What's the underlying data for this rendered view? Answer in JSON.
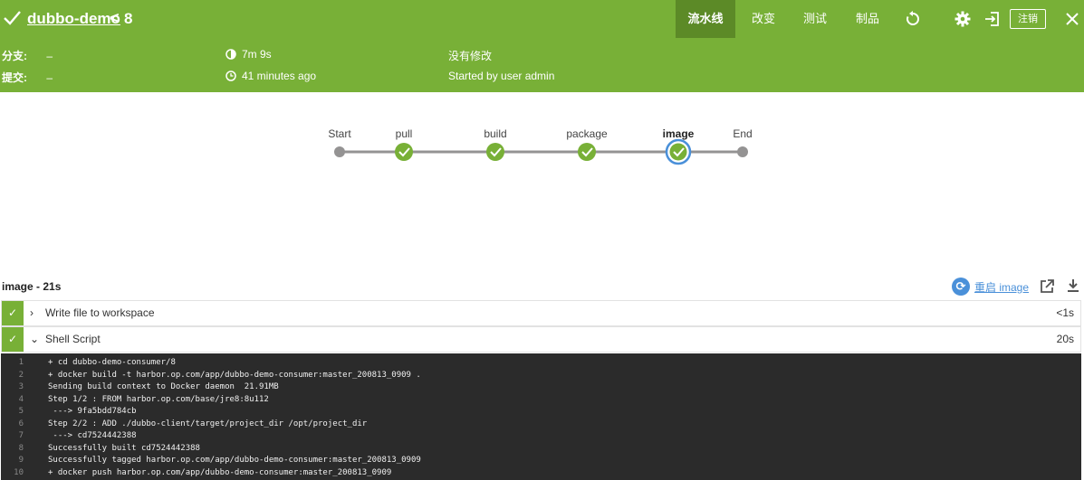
{
  "header": {
    "title": "dubbo-demo",
    "separator": "<",
    "run_number": "8",
    "tabs": [
      {
        "label": "流水线",
        "active": true
      },
      {
        "label": "改变",
        "active": false
      },
      {
        "label": "测试",
        "active": false
      },
      {
        "label": "制品",
        "active": false
      }
    ],
    "logout_label": "注销",
    "accent_color": "#78b037"
  },
  "meta": {
    "branch_label": "分支:",
    "branch_value": "–",
    "commit_label": "提交:",
    "commit_value": "–",
    "duration": "7m 9s",
    "time_ago": "41 minutes ago",
    "changes": "没有修改",
    "started_by": "Started by user admin"
  },
  "pipeline": {
    "stages": [
      {
        "label": "Start",
        "kind": "terminal"
      },
      {
        "label": "pull",
        "kind": "success"
      },
      {
        "label": "build",
        "kind": "success"
      },
      {
        "label": "package",
        "kind": "success"
      },
      {
        "label": "image",
        "kind": "current"
      },
      {
        "label": "End",
        "kind": "terminal"
      }
    ]
  },
  "step": {
    "title": "image - 21s",
    "restart_label": "重启 image"
  },
  "log_steps": [
    {
      "chevron": "›",
      "name": "Write file to workspace",
      "duration": "<1s"
    },
    {
      "chevron": "⌄",
      "name": "Shell Script",
      "duration": "20s"
    }
  ],
  "console": {
    "lines": [
      {
        "n": "1",
        "text": "+ cd dubbo-demo-consumer/8"
      },
      {
        "n": "2",
        "text": "+ docker build -t harbor.op.com/app/dubbo-demo-consumer:master_200813_0909 ."
      },
      {
        "n": "3",
        "text": "Sending build context to Docker daemon  21.91MB"
      },
      {
        "n": "4",
        "text": "Step 1/2 : FROM harbor.op.com/base/jre8:8u112"
      },
      {
        "n": "5",
        "text": " ---> 9fa5bdd784cb"
      },
      {
        "n": "6",
        "text": "Step 2/2 : ADD ./dubbo-client/target/project_dir /opt/project_dir"
      },
      {
        "n": "7",
        "text": " ---> cd7524442388"
      },
      {
        "n": "8",
        "text": "Successfully built cd7524442388"
      },
      {
        "n": "9",
        "text": "Successfully tagged harbor.op.com/app/dubbo-demo-consumer:master_200813_0909"
      },
      {
        "n": "10",
        "text": "+ docker push harbor.op.com/app/dubbo-demo-consumer:master_200813_0909"
      }
    ]
  }
}
